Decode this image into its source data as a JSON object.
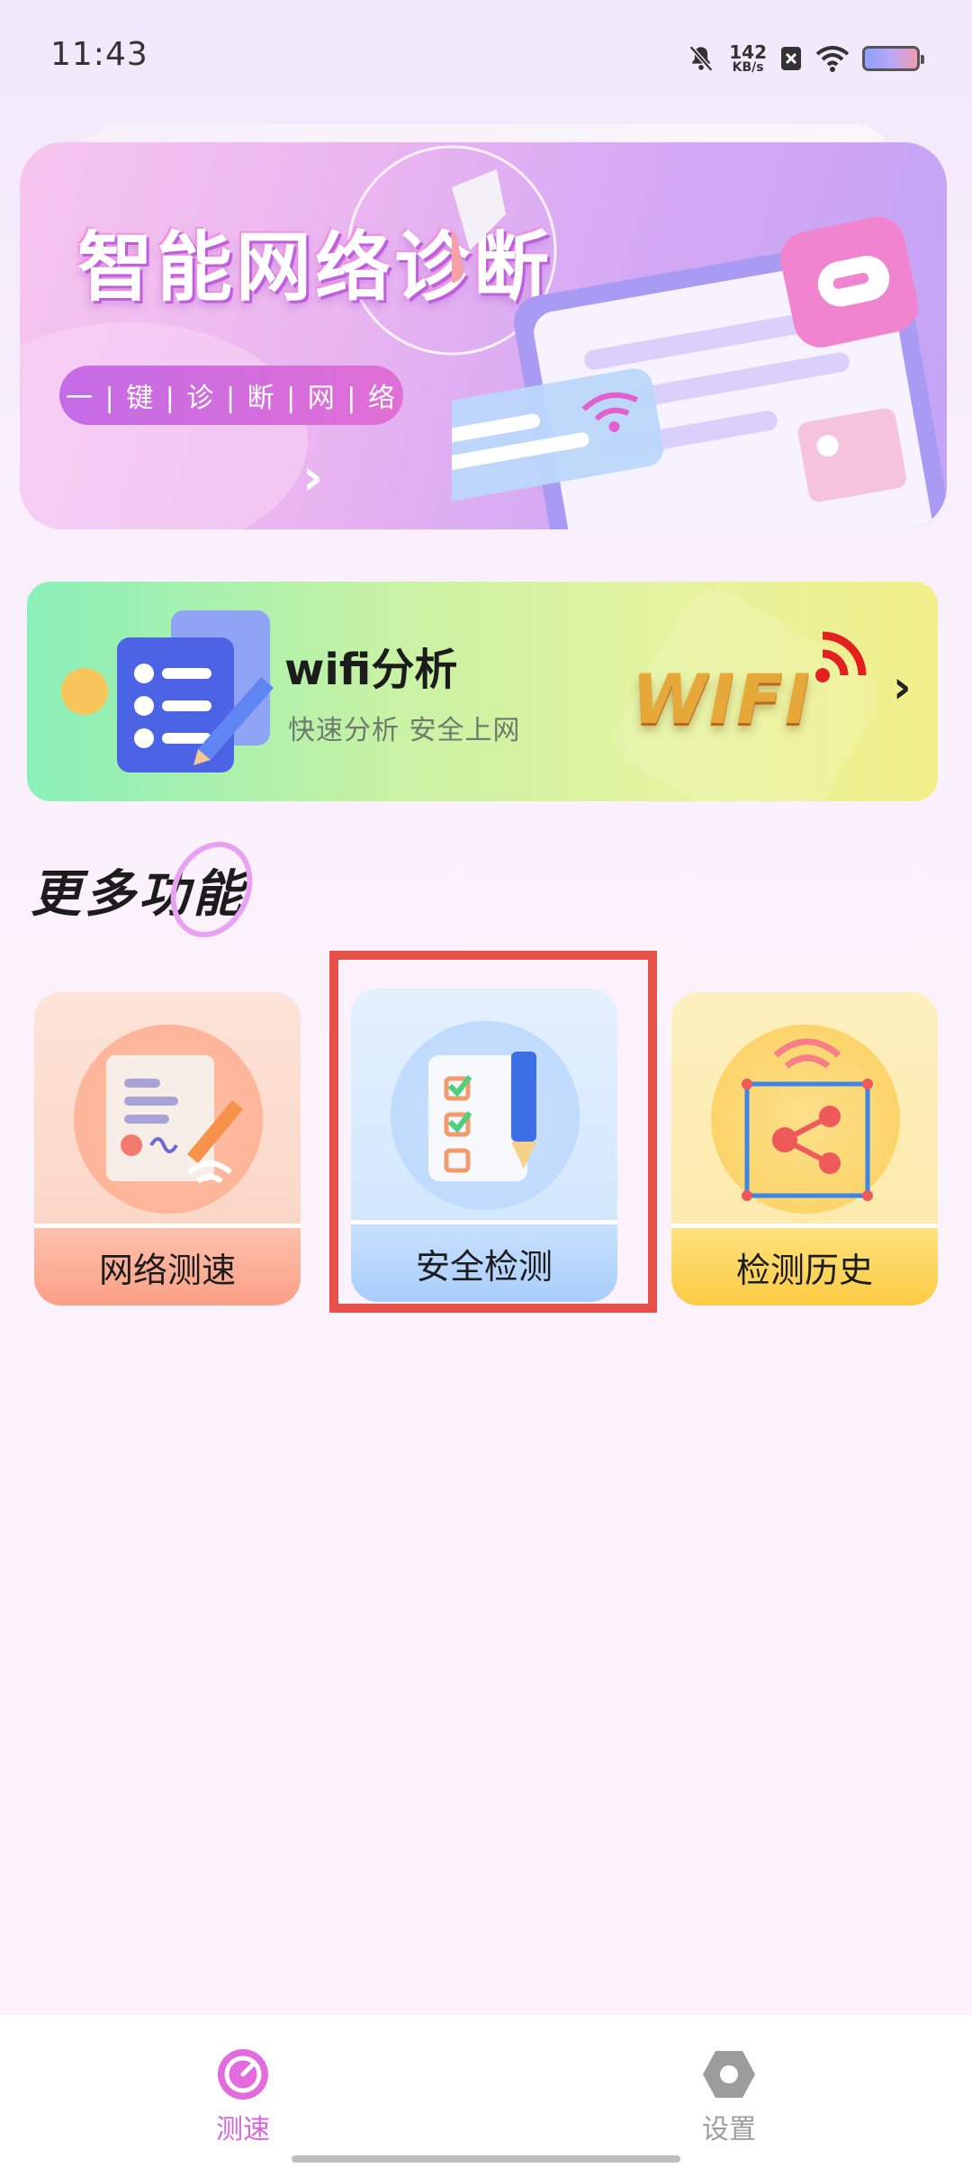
{
  "status_bar": {
    "time": "11:43",
    "net_speed_value": "142",
    "net_speed_unit": "KB/s"
  },
  "banner": {
    "title": "智能网络诊断",
    "pill": "一 | 键 | 诊 | 断 | 网 | 络",
    "arrow": "›"
  },
  "wifi_card": {
    "title": "wifi分析",
    "subtitle": "快速分析  安全上网",
    "art_text": "WIFI",
    "chevron": "›"
  },
  "section": {
    "title": "更多功能"
  },
  "features": [
    {
      "label": "网络测速",
      "icon": "receipt-pen-icon"
    },
    {
      "label": "安全检测",
      "icon": "checklist-pencil-icon"
    },
    {
      "label": "检测历史",
      "icon": "share-network-icon"
    }
  ],
  "bottom_nav": [
    {
      "label": "测速",
      "icon": "speedometer-icon",
      "active": true
    },
    {
      "label": "设置",
      "icon": "hexagon-settings-icon",
      "active": false
    }
  ],
  "colors": {
    "accent": "#dc63de",
    "highlight": "#e8504a"
  }
}
